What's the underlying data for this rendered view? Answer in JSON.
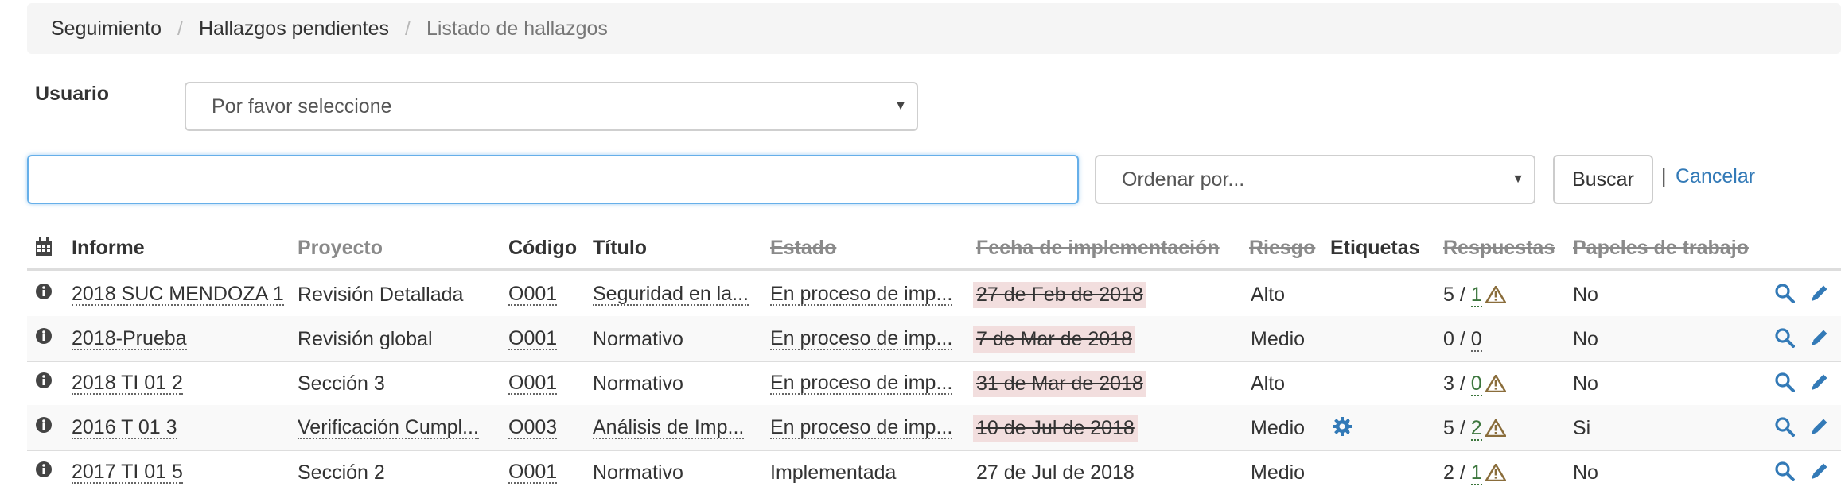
{
  "breadcrumb": [
    "Seguimiento",
    "Hallazgos pendientes",
    "Listado de hallazgos"
  ],
  "user": {
    "label": "Usuario",
    "selected": "Por favor seleccione"
  },
  "search": {
    "query": "",
    "order_by": "Ordenar por...",
    "button": "Buscar",
    "separator": "|",
    "cancel": "Cancelar"
  },
  "table": {
    "headers": {
      "informe": "Informe",
      "proyecto": "Proyecto",
      "codigo": "Código",
      "titulo": "Título",
      "estado": "Estado",
      "fecha": "Fecha de implementación",
      "riesgo": "Riesgo",
      "etiquetas": "Etiquetas",
      "respuestas": "Respuestas",
      "papeles": "Papeles de trabajo"
    },
    "rows": [
      {
        "informe": "2018 SUC MENDOZA 1",
        "proyecto": "Revisión Detallada",
        "codigo": "O001",
        "titulo": "Seguridad en la...",
        "estado": "En proceso de imp...",
        "fecha": "27 de Feb de 2018",
        "riesgo": "Alto",
        "respuestas_total": "5 /",
        "respuestas_pend": "1",
        "papeles": "No"
      },
      {
        "informe": "2018-Prueba",
        "proyecto": "Revisión global",
        "codigo": "O001",
        "titulo": "Normativo",
        "estado": "En proceso de imp...",
        "fecha": "7 de Mar de 2018",
        "riesgo": "Medio",
        "respuestas_total": "0 /",
        "respuestas_pend": "0",
        "papeles": "No"
      },
      {
        "informe": "2018 TI 01 2",
        "proyecto": "Sección 3",
        "codigo": "O001",
        "titulo": "Normativo",
        "estado": "En proceso de imp...",
        "fecha": "31 de Mar de 2018",
        "riesgo": "Alto",
        "respuestas_total": "3 /",
        "respuestas_pend": "0",
        "papeles": "No"
      },
      {
        "informe": "2016 T 01 3",
        "proyecto": "Verificación Cumpl...",
        "codigo": "O003",
        "titulo": "Análisis de Imp...",
        "estado": "En proceso de imp...",
        "fecha": "10 de Jul de 2018",
        "riesgo": "Medio",
        "respuestas_total": "5 /",
        "respuestas_pend": "2",
        "papeles": "Si"
      },
      {
        "informe": "2017 TI 01 5",
        "proyecto": "Sección 2",
        "codigo": "O001",
        "titulo": "Normativo",
        "estado": "Implementada",
        "fecha": "27 de Jul de 2018",
        "riesgo": "Medio",
        "respuestas_total": "2 /",
        "respuestas_pend": "1",
        "papeles": "No"
      }
    ]
  },
  "colors": {
    "link": "#337ab7",
    "warning": "#8a6d3b",
    "expired_bg": "#f2dede",
    "pending_green": "#3c763d"
  },
  "icons": [
    "calendar-icon",
    "info-icon",
    "warning-icon",
    "gear-icon",
    "search-icon",
    "pencil-icon"
  ]
}
